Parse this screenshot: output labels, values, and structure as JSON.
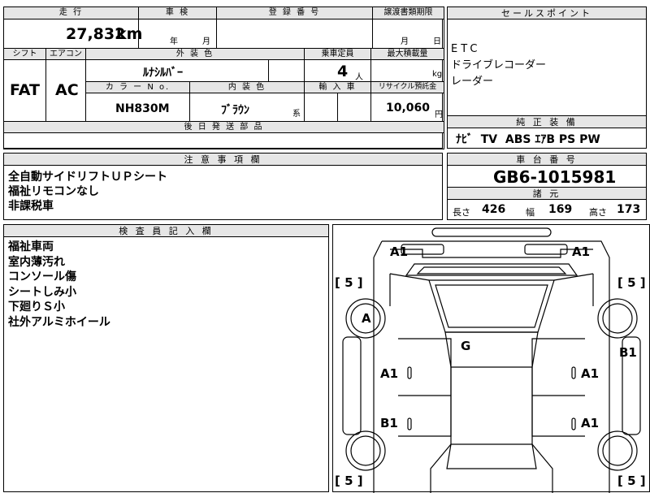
{
  "top": {
    "mileage_label": "走 行",
    "mileage_value": "27,832",
    "mileage_unit": "km",
    "inspection_label": "車 検",
    "inspection_year": "年",
    "inspection_month": "月",
    "registration_label": "登 録 番 号",
    "transfer_label": "譲渡書類期限",
    "transfer_month": "月",
    "transfer_day": "日",
    "shift_label": "シフト",
    "shift_value": "FAT",
    "ac_label": "エアコン",
    "ac_value": "AC",
    "exterior_label": "外 装 色",
    "exterior_value": "ﾙﾅｼﾙﾊﾞｰ",
    "capacity_label": "乗車定員",
    "capacity_value": "4",
    "capacity_unit": "人",
    "load_label": "最大積載量",
    "load_unit": "kg",
    "color_no_label": "カ ラ ー N o.",
    "color_no_value": "NH830M",
    "interior_label": "内 装 色",
    "interior_value": "ﾌﾞﾗｳﾝ",
    "interior_suffix": "系",
    "import_label": "輸 入 車",
    "recycle_label": "リサイクル預託金",
    "recycle_value": "10,060",
    "recycle_unit": "円",
    "later_parts_label": "後 日 発 送 部 品"
  },
  "selling_points": {
    "label": "セールスポイント",
    "items": [
      "ETC",
      "ドライブレコーダー",
      "レーダー"
    ]
  },
  "standard_equipment": {
    "label": "純 正 装 備",
    "value": "ﾅﾋﾞ  TV  ABS ｴｱB PS PW"
  },
  "notes": {
    "label": "注 意 事 項 欄",
    "items": [
      "全自動サイドリフトＵＰシート",
      "福祉リモコンなし",
      "非課税車"
    ]
  },
  "chassis": {
    "label": "車 台 番 号",
    "value": "GB6-1015981"
  },
  "specs": {
    "label": "諸 元",
    "length_label": "長さ",
    "length_value": "426",
    "width_label": "幅",
    "width_value": "169",
    "height_label": "高さ",
    "height_value": "173"
  },
  "inspector": {
    "label": "検 査 員 記 入 欄",
    "items": [
      "福祉車両",
      "室内薄汚れ",
      "コンソール傷",
      "シートしみ小",
      "下廻りＳ小",
      "社外アルミホイール"
    ]
  },
  "diagram": {
    "marks": {
      "a1_front_left": "A1",
      "a1_front_right": "A1",
      "tire_fl": "[ 5 ]",
      "tire_fr": "[ 5 ]",
      "tire_rl": "[ 5 ]",
      "tire_rr": "[ 5 ]",
      "wheel_a": "A",
      "roof_g": "G",
      "b1_right": "B1",
      "a1_left_front_door": "A1",
      "a1_right_front_door": "A1",
      "b1_left_rear_door": "B1",
      "a1_right_rear_door": "A1"
    }
  }
}
